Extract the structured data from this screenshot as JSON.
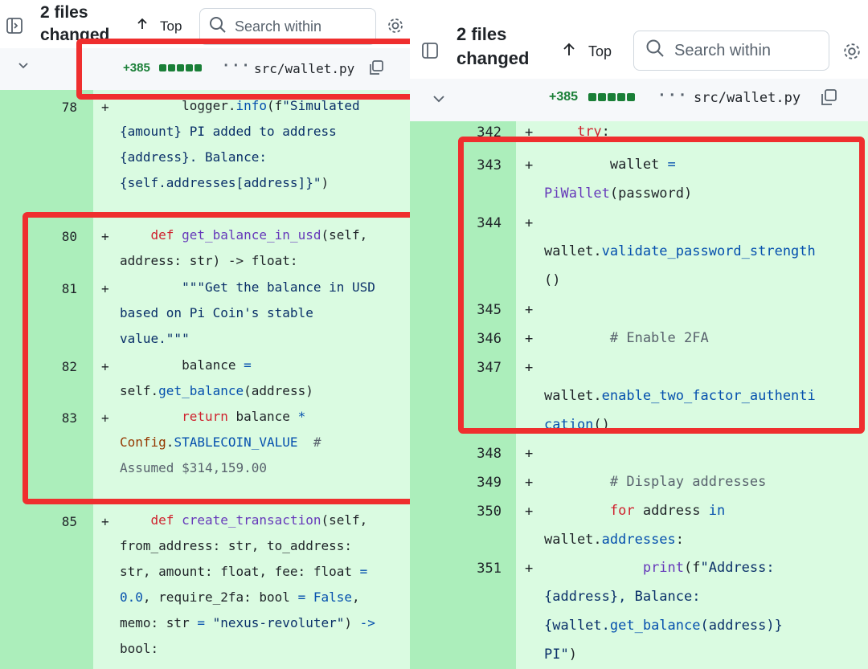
{
  "left": {
    "header": {
      "files_changed": [
        "2 files",
        "changed"
      ],
      "top_label": "Top",
      "search_placeholder": "Search within"
    },
    "file": {
      "additions": "+385",
      "path": "src/wallet.py"
    },
    "lines": [
      {
        "num": "78",
        "sign": "+",
        "code": [
          "        logger.info(f\"Simulated",
          "{amount} PI added to address",
          "{address}. Balance:",
          "{self.addresses[address]}\")"
        ]
      },
      {
        "num": "80",
        "sign": "+",
        "code": [
          "    def get_balance_in_usd(self,",
          "address: str) -> float:"
        ]
      },
      {
        "num": "81",
        "sign": "+",
        "code": [
          "        \"\"\"Get the balance in USD",
          "based on Pi Coin's stable",
          "value.\"\"\""
        ]
      },
      {
        "num": "82",
        "sign": "+",
        "code": [
          "        balance =",
          "self.get_balance(address)"
        ]
      },
      {
        "num": "83",
        "sign": "+",
        "code": [
          "        return balance *",
          "Config.STABLECOIN_VALUE  #",
          "Assumed $314,159.00"
        ]
      },
      {
        "num": "85",
        "sign": "+",
        "code": [
          "    def create_transaction(self,",
          "from_address: str, to_address:",
          "str, amount: float, fee: float =",
          "0.0, require_2fa: bool = False,",
          "memo: str = \"nexus-revoluter\") ->",
          "bool:"
        ]
      }
    ]
  },
  "right": {
    "header": {
      "files_changed": [
        "2 files",
        "changed"
      ],
      "top_label": "Top",
      "search_placeholder": "Search within"
    },
    "file": {
      "additions": "+385",
      "path": "src/wallet.py"
    },
    "lines": [
      {
        "num": "342",
        "sign": "+",
        "code": [
          "    try:"
        ]
      },
      {
        "num": "343",
        "sign": "+",
        "code": [
          "        wallet =",
          "PiWallet(password)"
        ]
      },
      {
        "num": "344",
        "sign": "+",
        "code": [
          "",
          "wallet.validate_password_strength",
          "()"
        ]
      },
      {
        "num": "345",
        "sign": "+",
        "code": [
          ""
        ]
      },
      {
        "num": "346",
        "sign": "+",
        "code": [
          "        # Enable 2FA"
        ]
      },
      {
        "num": "347",
        "sign": "+",
        "code": [
          "",
          "wallet.enable_two_factor_authenti",
          "cation()"
        ]
      },
      {
        "num": "348",
        "sign": "+",
        "code": [
          ""
        ]
      },
      {
        "num": "349",
        "sign": "+",
        "code": [
          "        # Display addresses"
        ]
      },
      {
        "num": "350",
        "sign": "+",
        "code": [
          "        for address in",
          "wallet.addresses:"
        ]
      },
      {
        "num": "351",
        "sign": "+",
        "code": [
          "            print(f\"Address:",
          "{address}, Balance:",
          "{wallet.get_balance(address)}",
          "PI\")"
        ]
      }
    ]
  },
  "colors": {
    "highlight_box": "#ef2e2e",
    "added_bg": "#dafbe1",
    "added_gutter": "#aceebb",
    "additions_text": "#1a7f37"
  },
  "icons": [
    "sidebar-toggle-icon",
    "arrow-up-icon",
    "search-icon",
    "gear-icon",
    "chevron-down-icon",
    "kebab-icon",
    "copy-icon"
  ]
}
